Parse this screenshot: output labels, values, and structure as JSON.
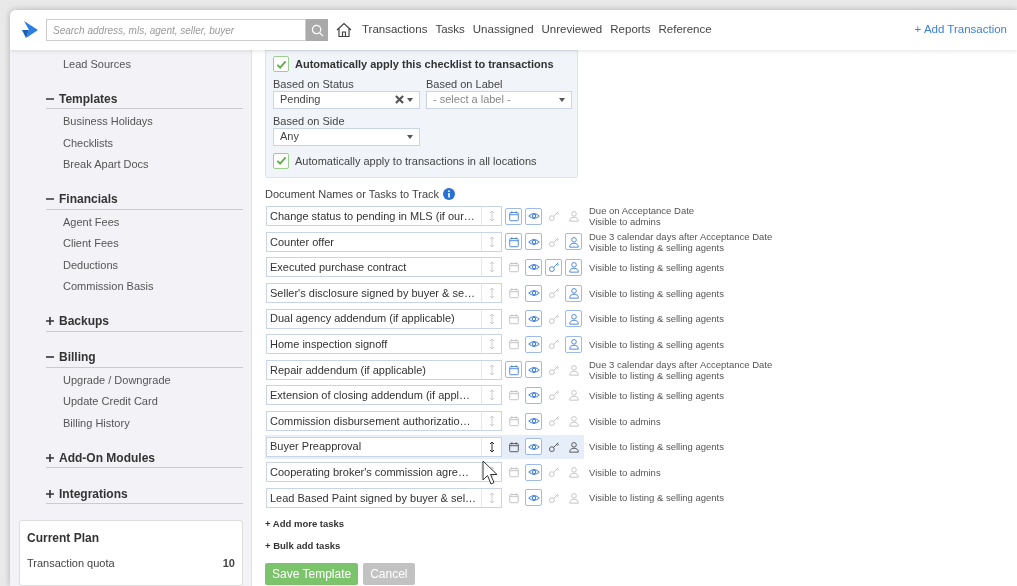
{
  "topbar": {
    "search": {
      "placeholder": "Search address, mls, agent, seller, buyer"
    },
    "nav": [
      "Transactions",
      "Tasks",
      "Unassigned",
      "Unreviewed",
      "Reports",
      "Reference"
    ],
    "add_button": "+ Add Transaction"
  },
  "sidebar": {
    "items": [
      "Lead Sources"
    ],
    "sections": [
      {
        "title": "Templates",
        "expanded": true,
        "children": [
          "Business Holidays",
          "Checklists",
          "Break Apart Docs"
        ]
      },
      {
        "title": "Financials",
        "expanded": true,
        "children": [
          "Agent Fees",
          "Client Fees",
          "Deductions",
          "Commission Basis"
        ]
      },
      {
        "title": "Backups",
        "expanded": false
      },
      {
        "title": "Billing",
        "expanded": true,
        "children": [
          "Upgrade / Downgrade",
          "Update Credit Card",
          "Billing History"
        ]
      },
      {
        "title": "Add-On Modules",
        "expanded": false
      },
      {
        "title": "Integrations",
        "expanded": false
      }
    ],
    "current_plan": {
      "title": "Current Plan",
      "rows": [
        {
          "label": "Transaction quota",
          "value": "10"
        }
      ]
    }
  },
  "auto_apply": {
    "checked": true,
    "label": "Automatically apply this checklist to transactions",
    "status": {
      "label": "Based on Status",
      "value": "Pending"
    },
    "label_select": {
      "label": "Based on Label",
      "placeholder": "- select a label -"
    },
    "side": {
      "label": "Based on Side",
      "value": "Any"
    },
    "all_locations": {
      "checked": true,
      "label": "Automatically apply to transactions in all locations"
    }
  },
  "tasks_heading": "Document Names or Tasks to Track",
  "tasks": [
    {
      "name": "Change status to pending in MLS (if our…",
      "due": true,
      "visible": true,
      "key": false,
      "assigned": false,
      "highlighted": false,
      "notes": [
        "Due on Acceptance Date",
        "Visible to admins"
      ]
    },
    {
      "name": "Counter offer",
      "due": true,
      "visible": true,
      "key": false,
      "assigned": true,
      "highlighted": false,
      "notes": [
        "Due 3 calendar days after Acceptance Date",
        "Visible to listing & selling agents"
      ]
    },
    {
      "name": "Executed purchase contract",
      "due": false,
      "visible": true,
      "key": true,
      "assigned": true,
      "highlighted": false,
      "notes": [
        "Visible to listing & selling agents"
      ]
    },
    {
      "name": "Seller's disclosure signed by buyer & se…",
      "due": false,
      "visible": true,
      "key": false,
      "assigned": true,
      "highlighted": false,
      "notes": [
        "Visible to listing & selling agents"
      ]
    },
    {
      "name": "Dual agency addendum (if applicable)",
      "due": false,
      "visible": true,
      "key": false,
      "assigned": true,
      "highlighted": false,
      "notes": [
        "Visible to listing & selling agents"
      ]
    },
    {
      "name": "Home inspection signoff",
      "due": false,
      "visible": true,
      "key": false,
      "assigned": true,
      "highlighted": false,
      "notes": [
        "Visible to listing & selling agents"
      ]
    },
    {
      "name": "Repair addendum (if applicable)",
      "due": true,
      "visible": true,
      "key": false,
      "assigned": false,
      "highlighted": false,
      "notes": [
        "Due 3 calendar days after Acceptance Date",
        "Visible to listing & selling agents"
      ]
    },
    {
      "name": "Extension of closing addendum (if appl…",
      "due": false,
      "visible": true,
      "key": false,
      "assigned": false,
      "highlighted": false,
      "notes": [
        "Visible to listing & selling agents"
      ]
    },
    {
      "name": "Commission disbursement authorizatio…",
      "due": false,
      "visible": true,
      "key": false,
      "assigned": false,
      "highlighted": false,
      "notes": [
        "Visible to admins"
      ]
    },
    {
      "name": "Buyer Preapproval",
      "due": false,
      "visible": true,
      "key": false,
      "assigned": false,
      "highlighted": true,
      "notes": [
        "Visible to listing & selling agents"
      ]
    },
    {
      "name": "Cooperating broker's commission agre…",
      "due": false,
      "visible": true,
      "key": false,
      "assigned": false,
      "highlighted": false,
      "notes": [
        "Visible to admins"
      ]
    },
    {
      "name": "Lead Based Paint signed by buyer & sel…",
      "due": false,
      "visible": true,
      "key": false,
      "assigned": false,
      "highlighted": false,
      "notes": [
        "Visible to listing & selling agents"
      ]
    }
  ],
  "links": [
    "+ Add more tasks",
    "+ Bulk add tasks"
  ],
  "buttons": [
    {
      "label": "Save Template",
      "kind": "primary"
    },
    {
      "label": "Cancel",
      "kind": "secondary"
    }
  ]
}
